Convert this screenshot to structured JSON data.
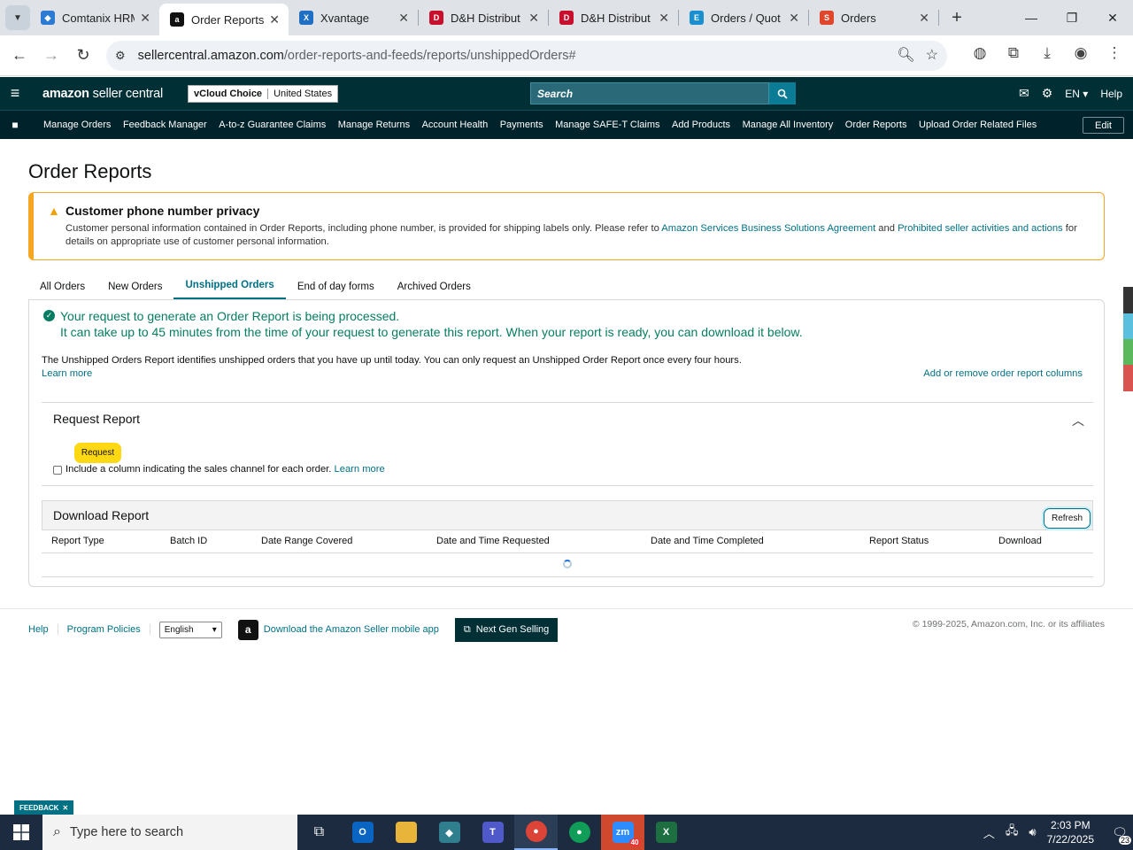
{
  "browser": {
    "tabs": [
      {
        "title": "Comtanix HRM",
        "icon": "comtanix-favicon",
        "color": "#2b7bd3"
      },
      {
        "title": "Order Reports",
        "icon": "amazon-favicon",
        "color": "#111111"
      },
      {
        "title": "Xvantage",
        "icon": "xvantage-favicon",
        "color": "#1f6fc5"
      },
      {
        "title": "D&H Distribut",
        "icon": "dh-favicon",
        "color": "#c8102e"
      },
      {
        "title": "D&H Distribut",
        "icon": "dh-favicon",
        "color": "#c8102e"
      },
      {
        "title": "Orders / Quot",
        "icon": "ec-favicon",
        "color": "#1a8fd0"
      },
      {
        "title": "Orders",
        "icon": "orders-favicon",
        "color": "#e0462a"
      }
    ],
    "url_host": "sellercentral.amazon.com",
    "url_path": "/order-reports-and-feeds/reports/unshippedOrders#"
  },
  "header": {
    "logo_text": "amazon",
    "logo_sub": "seller central",
    "account_name": "vCloud Choice",
    "marketplace": "United States",
    "search_placeholder": "Search",
    "lang": "EN",
    "help": "Help"
  },
  "nav": {
    "items": [
      "Manage Orders",
      "Feedback Manager",
      "A-to-z Guarantee Claims",
      "Manage Returns",
      "Account Health",
      "Payments",
      "Manage SAFE-T Claims",
      "Add Products",
      "Manage All Inventory",
      "Order Reports",
      "Upload Order Related Files"
    ],
    "edit": "Edit"
  },
  "page": {
    "title": "Order Reports",
    "alert": {
      "title": "Customer phone number privacy",
      "text_pre": "Customer personal information contained in Order Reports, including phone number, is provided for shipping labels only. Please refer to ",
      "link1": "Amazon Services Business Solutions Agreement",
      "text_mid": " and ",
      "link2": "Prohibited seller activities and actions",
      "text_post": " for details on appropriate use of customer personal information."
    },
    "tabs": [
      "All Orders",
      "New Orders",
      "Unshipped Orders",
      "End of day forms",
      "Archived Orders"
    ],
    "active_tab": "Unshipped Orders",
    "success_line1": "Your request to generate an Order Report is being processed.",
    "success_line2": "It can take up to 45 minutes from the time of your request to generate this report. When your report is ready, you can download it below.",
    "description": "The Unshipped Orders Report identifies unshipped orders that you have up until today. You can only request an Unshipped Order Report once every four hours.",
    "learn_more": "Learn more",
    "add_columns": "Add or remove order report columns",
    "request": {
      "title": "Request Report",
      "button": "Request",
      "checkbox_label": "Include a column indicating the sales channel for each order.",
      "learn_more": "Learn more"
    },
    "download": {
      "title": "Download Report",
      "refresh": "Refresh",
      "columns": [
        "Report Type",
        "Batch ID",
        "Date Range Covered",
        "Date and Time Requested",
        "Date and Time Completed",
        "Report Status",
        "Download"
      ]
    }
  },
  "footer": {
    "help": "Help",
    "policies": "Program Policies",
    "language": "English",
    "app_link": "Download the Amazon Seller mobile app",
    "next_gen": "Next Gen Selling",
    "copyright": "© 1999-2025, Amazon.com, Inc. or its affiliates",
    "feedback": "FEEDBACK"
  },
  "taskbar": {
    "search_placeholder": "Type here to search",
    "time": "2:03 PM",
    "date": "7/22/2025",
    "notifications": "23",
    "zoom_badge": "40"
  }
}
